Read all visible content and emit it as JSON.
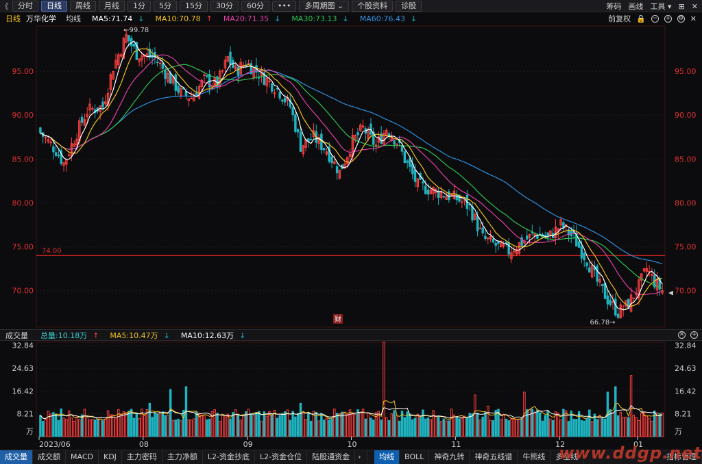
{
  "toolbar": {
    "back": "《",
    "buttons": [
      "分时",
      "日线",
      "周线",
      "月线",
      "1分",
      "5分",
      "15分",
      "30分",
      "60分",
      "•••",
      "多周期图",
      "个股资料",
      "诊股"
    ],
    "active": "日线",
    "multi_caret": "⌄",
    "right": [
      "筹码",
      "画线",
      "工具"
    ]
  },
  "info": {
    "period": "日线",
    "name": "万华化学",
    "label": "均线",
    "ma5": "MA5:71.74",
    "ma10": "MA10:70.78",
    "ma20": "MA20:71.35",
    "ma30": "MA30:73.13",
    "ma60": "MA60:76.43",
    "fq": "前复权"
  },
  "colors": {
    "up": "#ff4040",
    "down": "#1fb4c0",
    "ma5": "#ffffff",
    "ma10": "#f0c020",
    "ma20": "#e040a0",
    "ma30": "#30c050",
    "ma60": "#3090e0",
    "axis": "#e03030",
    "hline": "#c02020",
    "ma10_label": "#f0c020",
    "vol_total": "#3ad0d0"
  },
  "chart_data": {
    "type": "candlestick",
    "ylim": [
      66,
      100
    ],
    "y_ticks": [
      70,
      75,
      80,
      85,
      90,
      95
    ],
    "y_tick_labels": [
      "70.00",
      "75.00",
      "80.00",
      "85.00",
      "90.00",
      "95.00"
    ],
    "x_labels": [
      "2023/06",
      "08",
      "09",
      "10",
      "11",
      "12",
      "01"
    ],
    "hline": {
      "value": 74.0,
      "label": "74.00"
    },
    "annotations": {
      "max": "←99.78",
      "max_value": 99.78,
      "min": "66.78→",
      "min_value": 66.78
    },
    "fin_mark": "财",
    "anchors": [
      [
        0,
        88
      ],
      [
        6,
        86
      ],
      [
        9,
        84.5
      ],
      [
        14,
        88
      ],
      [
        18,
        90.5
      ],
      [
        24,
        91
      ],
      [
        28,
        95.5
      ],
      [
        33,
        99
      ],
      [
        37,
        97
      ],
      [
        44,
        96.5
      ],
      [
        49,
        94.5
      ],
      [
        54,
        92.5
      ],
      [
        58,
        92
      ],
      [
        63,
        94
      ],
      [
        68,
        93.5
      ],
      [
        72,
        96.5
      ],
      [
        75,
        95
      ],
      [
        79,
        96
      ],
      [
        85,
        94.5
      ],
      [
        91,
        93
      ],
      [
        96,
        91
      ],
      [
        100,
        86.5
      ],
      [
        105,
        87.5
      ],
      [
        110,
        86
      ],
      [
        115,
        83.5
      ],
      [
        120,
        87
      ],
      [
        124,
        88.5
      ],
      [
        129,
        86.5
      ],
      [
        133,
        88.5
      ],
      [
        137,
        87
      ],
      [
        140,
        85
      ],
      [
        145,
        82
      ],
      [
        150,
        81.5
      ],
      [
        155,
        81
      ],
      [
        160,
        80.5
      ],
      [
        165,
        79.5
      ],
      [
        170,
        76
      ],
      [
        176,
        75
      ],
      [
        180,
        74.5
      ],
      [
        185,
        75.5
      ],
      [
        190,
        76.5
      ],
      [
        195,
        76
      ],
      [
        200,
        77.5
      ],
      [
        205,
        76
      ],
      [
        210,
        73.5
      ],
      [
        214,
        71
      ],
      [
        218,
        69
      ],
      [
        222,
        67.5
      ],
      [
        226,
        68.5
      ],
      [
        230,
        70.5
      ],
      [
        233,
        72.5
      ],
      [
        236,
        71
      ],
      [
        239,
        70
      ]
    ],
    "volume": {
      "ylim": [
        0,
        34
      ],
      "y_tick_labels": [
        "32.84",
        "24.63",
        "16.42",
        "8.21",
        "万"
      ],
      "y_tick_values": [
        32.84,
        24.63,
        16.42,
        8.21
      ],
      "spikes": [
        [
          132,
          34
        ],
        [
          186,
          16
        ],
        [
          167,
          15
        ],
        [
          227,
          22
        ],
        [
          218,
          16
        ],
        [
          221,
          18
        ],
        [
          50,
          17
        ],
        [
          56,
          18
        ],
        [
          172,
          11
        ],
        [
          8,
          10
        ],
        [
          42,
          12
        ],
        [
          100,
          12
        ]
      ]
    }
  },
  "volbar": {
    "name": "成交量",
    "total": "总量:10.18万",
    "ma5": "MA5:10.47万",
    "ma10": "MA10:12.63万"
  },
  "bottom": {
    "left_tabs": [
      "成交量",
      "成交额",
      "MACD",
      "KDJ",
      "主力密码",
      "主力净额",
      "L2-资金抄底",
      "L2-资金仓位",
      "陆股通资金"
    ],
    "right_tabs": [
      "均线",
      "BOLL",
      "神奇九转",
      "神奇五线谱",
      "牛熊线",
      "多空线",
      "指标管理"
    ],
    "watermark": "www.ddgp.net"
  }
}
